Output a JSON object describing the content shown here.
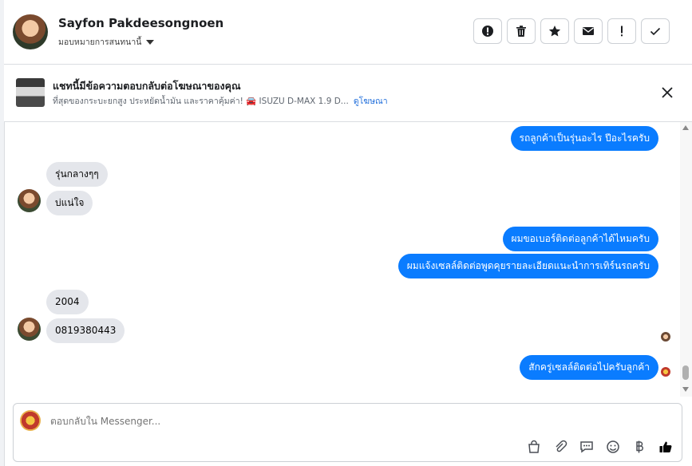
{
  "header": {
    "contact_name": "Sayfon Pakdeesongnoen",
    "assign_label": "มอบหมายการสนทนานี้",
    "actions": [
      {
        "icon": "alert-circle-icon",
        "name": "mark-spam-button"
      },
      {
        "icon": "trash-icon",
        "name": "delete-button"
      },
      {
        "icon": "star-icon",
        "name": "star-button"
      },
      {
        "icon": "envelope-icon",
        "name": "mark-unread-button"
      },
      {
        "icon": "exclamation-icon",
        "name": "follow-up-button"
      },
      {
        "icon": "check-icon",
        "name": "mark-done-button"
      }
    ]
  },
  "ad_banner": {
    "title": "แชทนี้มีข้อความตอบกลับต่อโฆษณาของคุณ",
    "subtitle": "ที่สุดของกระบะยกสูง ประหยัดน้ำมัน และราคาคุ้มค่า! 🚘 ISUZU D-MAX 1.9 D...",
    "link": "ดูโฆษณา"
  },
  "messages": [
    {
      "dir": "out",
      "text": "รถลูกค้าเป็นรุ่นอะไร ปีอะไรครับ"
    },
    {
      "dir": "in",
      "text": "รุ่นกลางๆๆ"
    },
    {
      "dir": "in",
      "text": "บ่แน่ใจ"
    },
    {
      "dir": "out",
      "text": "ผมขอเบอร์ติดต่อลูกค้าได้ไหมครับ"
    },
    {
      "dir": "out",
      "text": "ผมแจ้งเซลล์ติดต่อพูดคุยรายละเอียดแนะนำการเทิร์นรถครับ"
    },
    {
      "dir": "in",
      "text": "2004"
    },
    {
      "dir": "in",
      "text": "0819380443"
    },
    {
      "dir": "out",
      "text": "สักครู่เซลล์ติดต่อไปครับลูกค้า"
    }
  ],
  "composer": {
    "placeholder": "ตอบกลับใน Messenger...",
    "tools": [
      "bag-icon",
      "paperclip-icon",
      "saved-reply-icon",
      "emoji-icon",
      "baht-icon",
      "thumbs-up-icon"
    ]
  },
  "colors": {
    "outgoing_bubble": "#0a7cff",
    "incoming_bubble": "#e4e6eb",
    "link": "#216fdb"
  }
}
